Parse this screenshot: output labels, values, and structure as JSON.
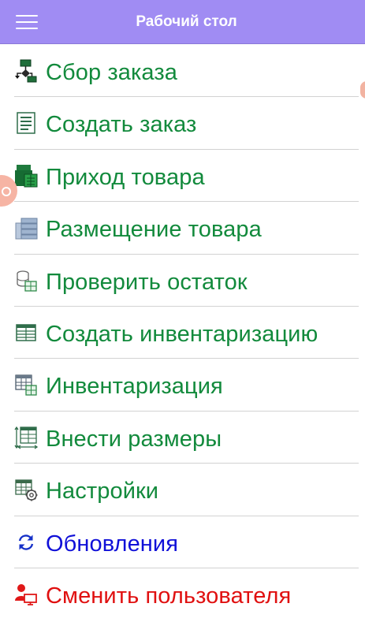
{
  "appbar": {
    "title": "Рабочий стол",
    "color": "#a08cf3",
    "menu_icon": "hamburger-menu-icon"
  },
  "menu": {
    "items": [
      {
        "label": "Сбор заказа",
        "icon": "order-picking-flow-icon",
        "color": "#128a3c"
      },
      {
        "label": "Создать заказ",
        "icon": "document-list-icon",
        "color": "#128a3c"
      },
      {
        "label": "Приход товара",
        "icon": "goods-receipt-icon",
        "color": "#128a3c"
      },
      {
        "label": "Размещение товара",
        "icon": "storage-racks-icon",
        "color": "#128a3c"
      },
      {
        "label": "Проверить остаток",
        "icon": "stock-check-icon",
        "color": "#128a3c"
      },
      {
        "label": "Создать инвентаризацию",
        "icon": "inventory-table-icon",
        "color": "#128a3c"
      },
      {
        "label": "Инвентаризация",
        "icon": "inventory-grid-icon",
        "color": "#128a3c"
      },
      {
        "label": "Внести размеры",
        "icon": "dimensions-table-icon",
        "color": "#128a3c"
      },
      {
        "label": "Настройки",
        "icon": "settings-table-gear-icon",
        "color": "#128a3c"
      },
      {
        "label": "Обновления",
        "icon": "refresh-arrows-icon",
        "color": "#1010d8"
      },
      {
        "label": "Сменить пользователя",
        "icon": "switch-user-icon",
        "color": "#e01010"
      }
    ]
  },
  "overlays": {
    "left_bubble": "floating-assist-bubble",
    "right_bubble": "floating-edge-handle"
  }
}
